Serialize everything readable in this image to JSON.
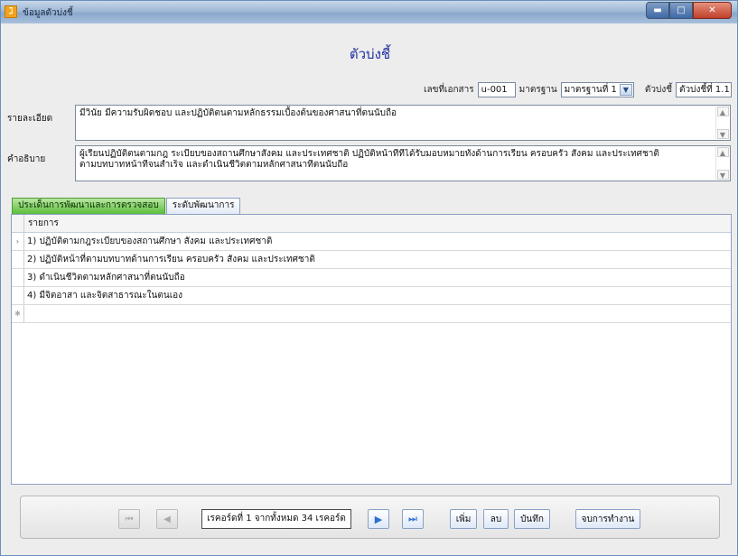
{
  "window": {
    "title": "ข้อมูลตัวบ่งชี้",
    "icon": "app-icon"
  },
  "form": {
    "title": "ตัวบ่งชี้"
  },
  "header": {
    "doc_no_label": "เลขที่เอกสาร",
    "doc_no_value": "u-001",
    "standard_label": "มาตรฐาน",
    "standard_value": "มาตรฐานที่ 1",
    "indicator_label": "ตัวบ่งชี้",
    "indicator_value": "ตัวบ่งชี้ที่ 1.1"
  },
  "details": {
    "label": "รายละเอียด",
    "value": "มีวินัย มีความรับผิดชอบ และปฏิบัติตนตามหลักธรรมเบื้องต้นของศาสนาที่ตนนับถือ"
  },
  "explanation": {
    "label": "คำอธิบาย",
    "line1": "ผู้เรียนปฏิบัติตนตามกฎ ระเบียบของสถานศึกษาสังคม และประเทศชาติ ปฏิบัติหน้าที่ที่ได้รับมอบหมายทั้งด้านการเรียน ครอบครัว สังคม และประเทศชาติ",
    "line2": "ตามบทบาทหน้าที่จนสำเร็จ และดำเนินชีวิตตามหลักศาสนาที่ตนนับถือ"
  },
  "tabs": [
    "ประเด็นการพัฒนาและการตรวจสอบ",
    "ระดับพัฒนาการ"
  ],
  "grid": {
    "column_header": "รายการ",
    "rows": [
      "1) ปฏิบัติตามกฎระเบียบของสถานศึกษา สังคม และประเทศชาติ",
      "2) ปฏิบัติหน้าที่ตามบทบาทด้านการเรียน ครอบครัว สังคม และประเทศชาติ",
      "3) ดำเนินชีวิตตามหลักศาสนาที่ตนนับถือ",
      "4) มีจิตอาสา และจิตสาธารณะในตนเอง"
    ]
  },
  "navigator": {
    "record_text": "เรคอร์ดที่ 1 จากทั้งหมด 34 เรคอร์ด",
    "add_label": "เพิ่ม",
    "delete_label": "ลบ",
    "save_label": "บันทึก",
    "finish_label": "จบการทำงาน"
  }
}
